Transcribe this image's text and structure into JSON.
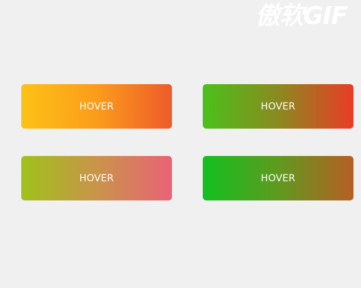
{
  "watermark": {
    "text": "傲软GIF"
  },
  "buttons": [
    {
      "label": "HOVER",
      "colors": [
        "#fdc215",
        "#fb9c1b",
        "#ee5b2a"
      ]
    },
    {
      "label": "HOVER",
      "colors": [
        "#4ac11a",
        "#8a8a20",
        "#ea3c26"
      ]
    },
    {
      "label": "HOVER",
      "colors": [
        "#9fc21a",
        "#c9944a",
        "#ea6276"
      ]
    },
    {
      "label": "HOVER",
      "colors": [
        "#11c11f",
        "#5f9a1f",
        "#b65f24"
      ]
    }
  ]
}
